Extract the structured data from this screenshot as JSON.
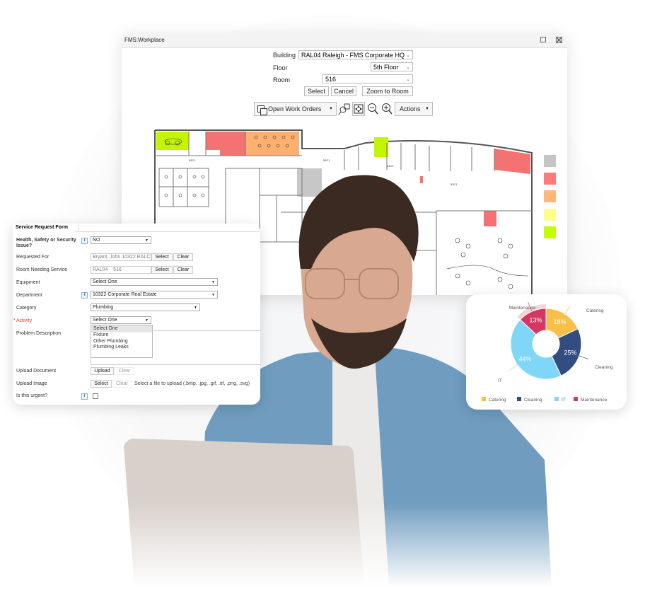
{
  "workplace": {
    "title": "FMS:Workplace",
    "building_label": "Building",
    "building_value": "RAL04 Raleigh - FMS Corporate HQ",
    "floor_label": "Floor",
    "floor_value": "5th Floor",
    "room_label": "Room",
    "room_value": "516",
    "buttons": {
      "select": "Select",
      "cancel": "Cancel",
      "zoom_to_room": "Zoom to Room"
    },
    "toolbar": {
      "layer": "Open Work Orders",
      "actions": "Actions"
    },
    "legend_colors": [
      "#c4c4c4",
      "#ff7b7b",
      "#ffb77a",
      "#ffff88",
      "#c3ff00"
    ],
    "highlight_colors": {
      "green": "#c3f400",
      "red": "#f47272",
      "orange": "#ffb071",
      "grey": "#c7c7c7"
    }
  },
  "form": {
    "tab": "Service Request Form",
    "fields": {
      "hss_label": "Health, Safety or Security Issue?",
      "hss_value": "NO",
      "requested_for_label": "Requested For",
      "requested_for_value": "Bryant, John 10322 RALC",
      "room_label": "Room Needing Service",
      "room_value": "RAL04    516",
      "equipment_label": "Equipment",
      "equipment_value": "Select One",
      "department_label": "Department",
      "department_value": "10322 Corporate Real Estate",
      "category_label": "Category",
      "category_value": "Plumbing",
      "activity_label": "Activity",
      "activity_value": "Select One",
      "problem_label": "Problem Description",
      "upload_doc_label": "Upload Document",
      "upload_img_label": "Upload Image",
      "upload_hint": "Select a file to upload (.bmp, .jpg, .gif, .tif, .png, .svg)",
      "urgent_label": "Is this urgent?"
    },
    "buttons": {
      "select": "Select",
      "clear": "Clear",
      "upload": "Upload"
    },
    "activity_options": [
      "Select One",
      "Fixture",
      "Other Plumbing",
      "Plumbing Leaks"
    ],
    "info_glyph": "i",
    "required_mark": "*"
  },
  "chart_data": {
    "type": "pie",
    "title": "",
    "categories": [
      "Catering",
      "Cleaning",
      "IT",
      "Maintenance"
    ],
    "values": [
      18,
      25,
      44,
      13
    ],
    "labels": [
      "18%",
      "25%",
      "44%",
      "13%"
    ],
    "colors": [
      "#f9bf48",
      "#334d80",
      "#7fd6f7",
      "#d43862"
    ],
    "donut": true,
    "legend": "bottom"
  }
}
